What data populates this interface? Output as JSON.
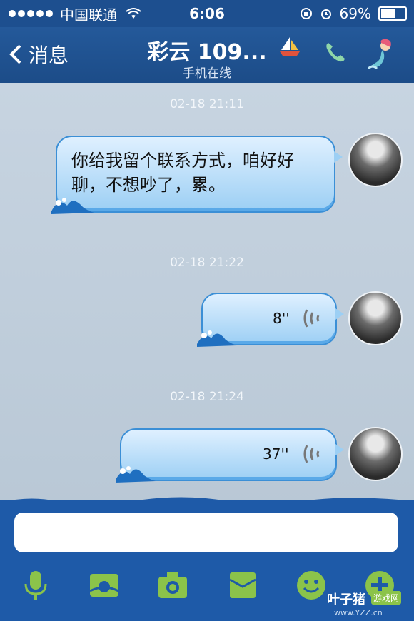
{
  "status_bar": {
    "carrier": "中国联通",
    "time": "6:06",
    "battery": "69%",
    "battery_level": 0.69
  },
  "nav": {
    "back_label": "消息",
    "title": "彩云 109...",
    "subtitle": "手机在线"
  },
  "messages": [
    {
      "timestamp": "02-18 21:11",
      "type": "text",
      "text": "你给我留个联系方式，咱好好聊，不想吵了，累。"
    },
    {
      "timestamp": "02-18 21:22",
      "type": "voice",
      "duration": "8''"
    },
    {
      "timestamp": "02-18 21:24",
      "type": "voice",
      "duration": "37''"
    }
  ],
  "input": {
    "value": ""
  },
  "toolbar": {
    "icons": [
      "microphone-icon",
      "image-icon",
      "camera-icon",
      "folder-icon",
      "emoji-icon",
      "plus-icon"
    ]
  },
  "watermark": {
    "text": "叶子猪",
    "badge": "游戏网",
    "url": "www.YZZ.cn"
  },
  "colors": {
    "nav_bg": "#1d4f8f",
    "chat_bg": "#c3d1de",
    "bubble": "#9ccff4",
    "toolbar_green": "#8bc34a"
  }
}
